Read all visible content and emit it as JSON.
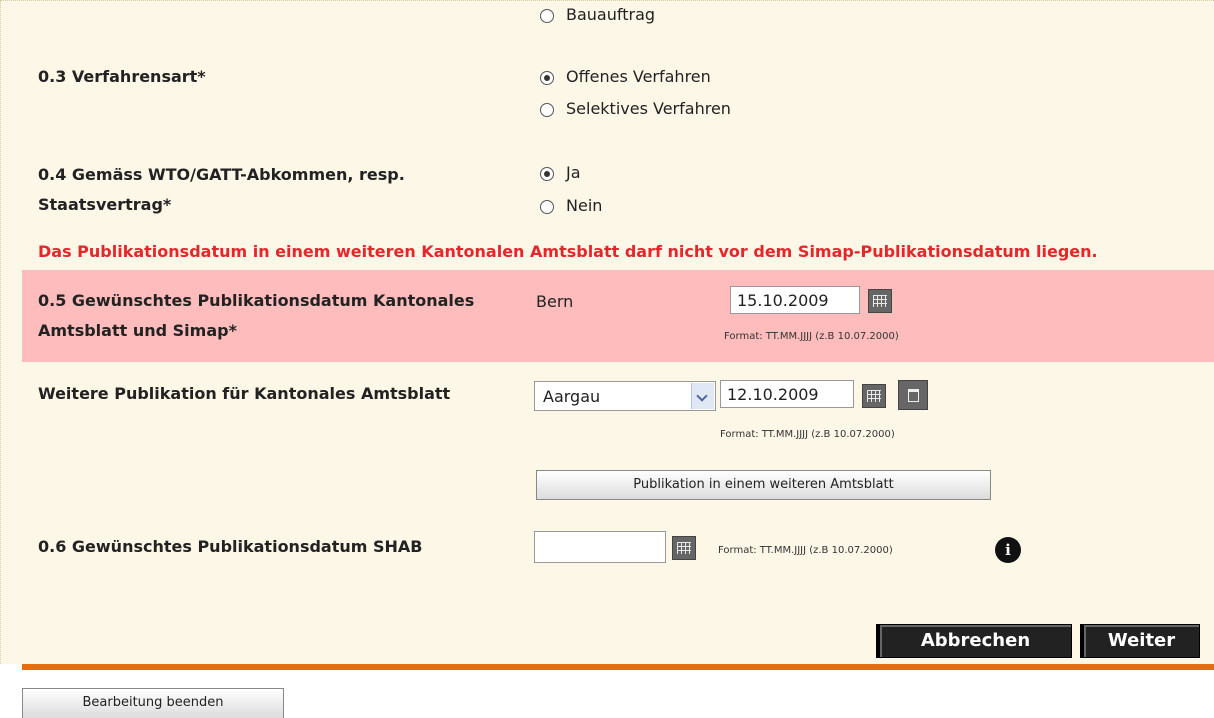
{
  "type_of_contract": {
    "partial_option": "Bauauftrag"
  },
  "procedure": {
    "label": "0.3 Verfahrensart*",
    "options": [
      "Offenes Verfahren",
      "Selektives Verfahren"
    ],
    "selected": "Offenes Verfahren"
  },
  "wto": {
    "label_line1": "0.4 Gemäss WTO/GATT-Abkommen, resp.",
    "label_line2": "Staatsvertrag*",
    "options": [
      "Ja",
      "Nein"
    ],
    "selected": "Ja"
  },
  "warning": "Das Publikationsdatum in einem weiteren Kantonalen Amtsblatt darf nicht vor dem Simap-Publikationsdatum liegen.",
  "pub_date": {
    "label_line1": "0.5 Gewünschtes Publikationsdatum Kantonales",
    "label_line2": "Amtsblatt und Simap*",
    "canton": "Bern",
    "date_value": "15.10.2009",
    "format_hint": "Format: TT.MM.JJJJ (z.B 10.07.2000)"
  },
  "further_pub": {
    "label": "Weitere Publikation für Kantonales Amtsblatt",
    "selected_canton": "Aargau",
    "date_value": "12.10.2009",
    "format_hint": "Format: TT.MM.JJJJ (z.B 10.07.2000)",
    "add_button": "Publikation in einem weiteren Amtsblatt"
  },
  "shab": {
    "label": "0.6 Gewünschtes Publikationsdatum SHAB",
    "date_value": "",
    "format_hint": "Format: TT.MM.JJJJ (z.B 10.07.2000)",
    "info_glyph": "i"
  },
  "actions": {
    "cancel": "Abbrechen",
    "next": "Weiter"
  },
  "footer": {
    "end_editing": "Bearbeitung beenden"
  },
  "colors": {
    "panel_bg": "#fdf7e8",
    "highlight_bg": "#ffbcbc",
    "warning_text": "#e8252a",
    "accent_line": "#e46d0f"
  }
}
